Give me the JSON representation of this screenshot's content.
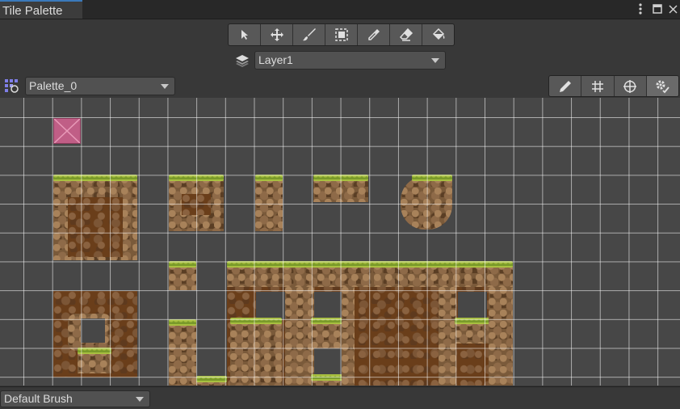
{
  "window": {
    "tab_title": "Tile Palette",
    "menu_icon": "kebab-menu-icon",
    "maximize_icon": "maximize-icon",
    "close_icon": "close-icon"
  },
  "toolbar": {
    "tools": [
      {
        "name": "select-tool",
        "icon": "arrow-cursor-icon"
      },
      {
        "name": "move-tool",
        "icon": "move-arrows-icon"
      },
      {
        "name": "paint-tool",
        "icon": "brush-icon"
      },
      {
        "name": "box-fill-tool",
        "icon": "box-fill-icon"
      },
      {
        "name": "pick-tool",
        "icon": "eyedropper-icon"
      },
      {
        "name": "erase-tool",
        "icon": "eraser-icon"
      },
      {
        "name": "flood-fill-tool",
        "icon": "paint-bucket-icon"
      }
    ]
  },
  "target": {
    "layer_icon": "layers-icon",
    "selected": "Layer1"
  },
  "palette": {
    "icon": "palette-grid-icon",
    "selected": "Palette_0"
  },
  "palette_tools": [
    {
      "name": "edit-palette",
      "icon": "pencil-icon"
    },
    {
      "name": "toggle-grid",
      "icon": "grid-icon"
    },
    {
      "name": "toggle-gizmos",
      "icon": "gizmo-icon"
    },
    {
      "name": "palette-settings",
      "icon": "settings-icon"
    }
  ],
  "brush": {
    "selected": "Default Brush"
  },
  "colors": {
    "accent": "#3a79bb",
    "background": "#383838",
    "canvas": "#474747",
    "grass": "#7a9a2a",
    "dirt": "#6a3e1a",
    "rock": "#7a5a3a",
    "pink_tile": "#c05e86"
  }
}
